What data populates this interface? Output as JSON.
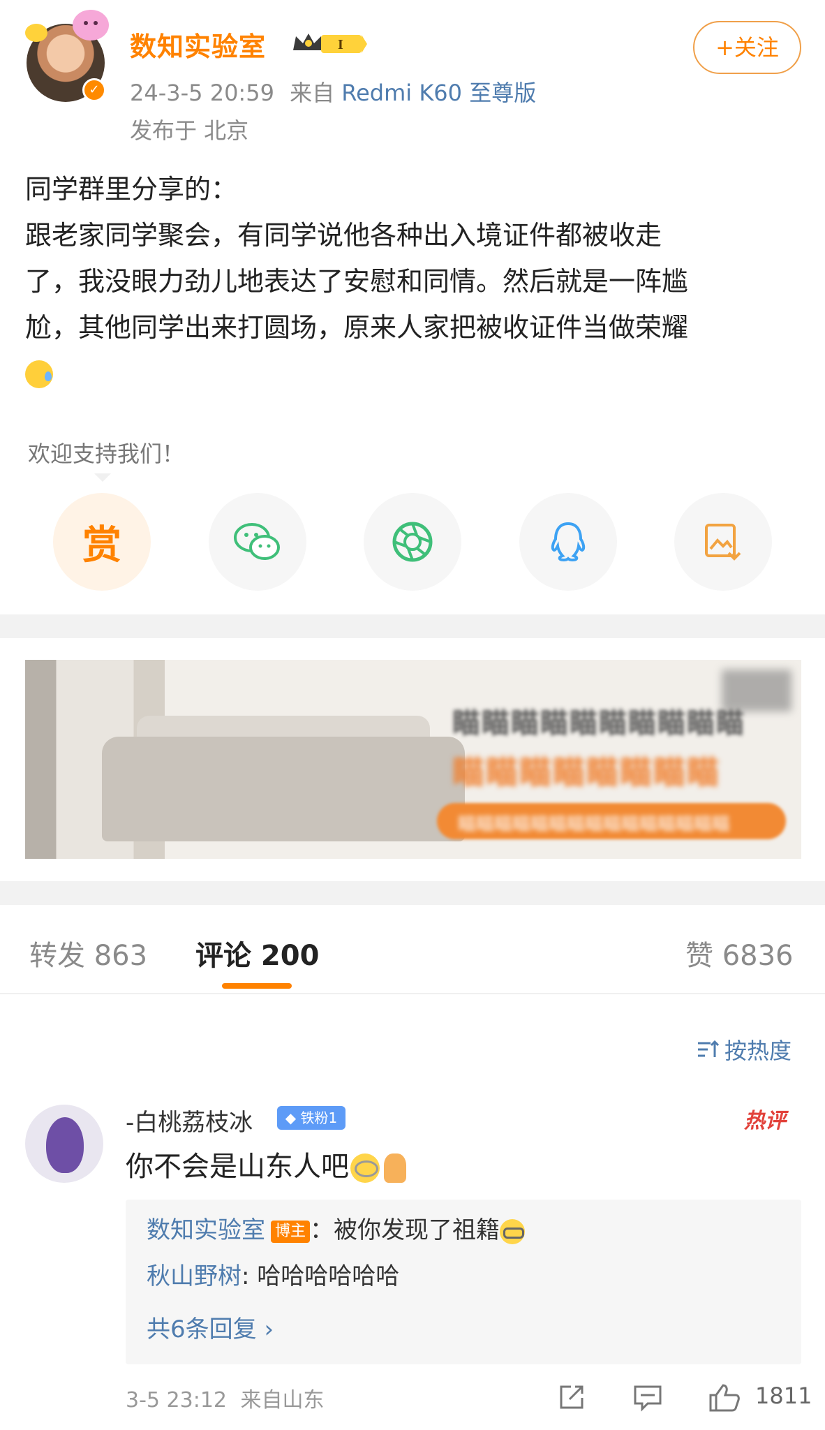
{
  "post": {
    "username": "数知实验室",
    "vip_level": "I",
    "time": "24-3-5 20:59",
    "source_prefix": "来自",
    "device": "Redmi K60 至尊版",
    "location": "发布于 北京",
    "follow_label": "+关注",
    "lines": [
      "同学群里分享的：",
      "跟老家同学聚会，有同学说他各种出入境证件都被收走",
      "了，我没眼力劲儿地表达了安慰和同情。然后就是一阵尴",
      "尬，其他同学出来打圆场，原来人家把被收证件当做荣耀"
    ],
    "trailing_emoji": "sweat-smile-emoji"
  },
  "support": {
    "tip": "欢迎支持我们！",
    "reward_label": "赏",
    "icons": [
      "reward-icon",
      "wechat-icon",
      "moments-icon",
      "qq-icon",
      "save-image-icon"
    ]
  },
  "banner": {
    "line1": "瞄瞄瞄瞄瞄瞄瞄瞄瞄瞄",
    "line2": "瞄瞄瞄瞄瞄瞄瞄瞄",
    "pill": "瞄瞄瞄瞄瞄瞄瞄瞄瞄瞄瞄瞄瞄瞄瞄"
  },
  "tabs": {
    "repost": "转发 863",
    "comments": "评论 200",
    "likes": "赞 6836"
  },
  "sort": {
    "label": "按热度"
  },
  "comment": {
    "username": "-白桃荔枝冰",
    "fan_badge": "铁粉1",
    "hot_tag": "热评",
    "text": "你不会是山东人吧",
    "replies": [
      {
        "name": "数知实验室",
        "badge": "博主",
        "text": "：被你发现了祖籍"
      },
      {
        "name": "秋山野树",
        "text": ": 哈哈哈哈哈哈"
      }
    ],
    "more_replies": "共6条回复 ›",
    "time": "3-5 23:12",
    "from": "来自山东",
    "likes": "1811"
  },
  "colors": {
    "accent": "#ff8200",
    "link": "#4f7cae",
    "hot": "#e2423b"
  }
}
